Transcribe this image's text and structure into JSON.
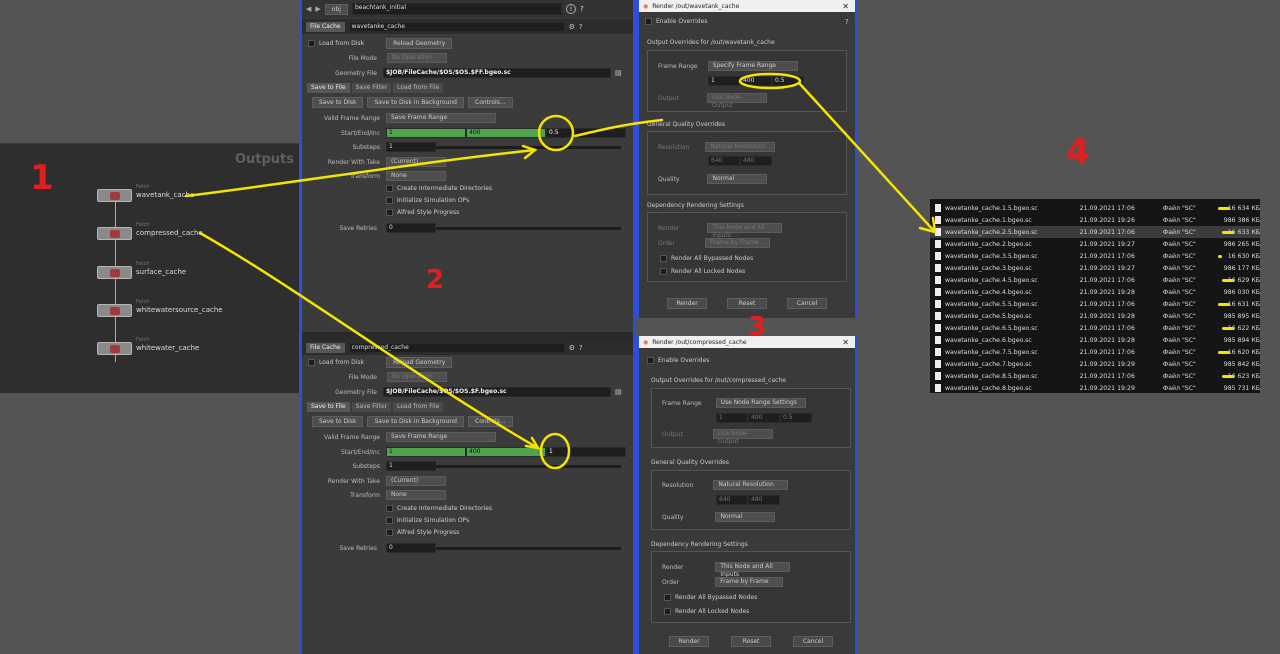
{
  "annotations": {
    "n1": "1",
    "n2": "2",
    "n3": "3",
    "n4": "4"
  },
  "outputs": {
    "title": "Outputs",
    "nodes": [
      {
        "type": "Fetch",
        "name": "wavetank_cache"
      },
      {
        "type": "Fetch",
        "name": "compressed_cache"
      },
      {
        "type": "Fetch",
        "name": "surface_cache"
      },
      {
        "type": "Fetch",
        "name": "whitewatersource_cache"
      },
      {
        "type": "Fetch",
        "name": "whitewater_cache"
      }
    ]
  },
  "path_bar": {
    "obj": "obj",
    "node": "beachtank_initial"
  },
  "fc1": {
    "node_type": "File Cache",
    "node_name": "wavetanke_cache",
    "load_from_disk": "Load from Disk",
    "reload": "Reload Geometry",
    "file_mode_label": "File Mode",
    "file_mode": "No Operation",
    "geo_label": "Geometry File",
    "geo_file": "$JOB/FileCache/$OS/$OS.$FF.bgeo.sc",
    "tabs": [
      "Save to File",
      "Save Filter",
      "Load from File"
    ],
    "save_btns": [
      "Save to Disk",
      "Save to Disk in Background",
      "Controls..."
    ],
    "valid_label": "Valid Frame Range",
    "valid": "Save Frame Range",
    "sei_label": "Start/End/Inc",
    "start": "1",
    "end": "400",
    "inc": "0.5",
    "substeps_label": "Substeps",
    "substeps": "1",
    "take_label": "Render With Take",
    "take": "(Current)",
    "transform_label": "Transform",
    "transform": "None",
    "chk": [
      "Create Intermediate Directories",
      "Initialize Simulation OPs",
      "Alfred Style Progress"
    ],
    "retries_label": "Save Retries",
    "retries": "0"
  },
  "fc2": {
    "node_type": "File Cache",
    "node_name": "compressed_cache",
    "load_from_disk": "Load from Disk",
    "reload": "Reload Geometry",
    "file_mode_label": "File Mode",
    "file_mode": "No Operation",
    "geo_label": "Geometry File",
    "geo_file": "$JOB/FileCache/$OS/$OS.$F.bgeo.sc",
    "tabs": [
      "Save to File",
      "Save Filter",
      "Load from File"
    ],
    "save_btns": [
      "Save to Disk",
      "Save to Disk in Background",
      "Controls..."
    ],
    "valid_label": "Valid Frame Range",
    "valid": "Save Frame Range",
    "sei_label": "Start/End/Inc",
    "start": "1",
    "end": "400",
    "inc": "1",
    "substeps_label": "Substeps",
    "substeps": "1",
    "take_label": "Render With Take",
    "take": "(Current)",
    "transform_label": "Transform",
    "transform": "None",
    "chk": [
      "Create Intermediate Directories",
      "Initialize Simulation OPs",
      "Alfred Style Progress"
    ],
    "retries_label": "Save Retries",
    "retries": "0"
  },
  "r1": {
    "title": "Render /out/wavetank_cache",
    "enable": "Enable Overrides",
    "out_group": "Output Overrides for /out/wavetank_cache",
    "fr_label": "Frame Range",
    "fr": "Specify Frame Range",
    "f1": "1",
    "f2": "400",
    "f3": "0.5",
    "out_label": "Output",
    "out": "Use Node Output",
    "q_group": "General Quality Overrides",
    "res_label": "Resolution",
    "res": "Natural Resolution",
    "w": "640",
    "h": "480",
    "qual_label": "Quality",
    "qual": "Normal",
    "dep_group": "Dependency Rendering Settings",
    "render_label": "Render",
    "render": "This Node and All Inputs",
    "order_label": "Order",
    "order": "Frame by Frame",
    "bypassed": "Render All Bypassed Nodes",
    "locked": "Render All Locked Nodes",
    "buttons": [
      "Render",
      "Reset",
      "Cancel"
    ]
  },
  "r2": {
    "title": "Render /out/compressed_cache",
    "enable": "Enable Overrides",
    "out_group": "Output Overrides for /out/compressed_cache",
    "fr_label": "Frame Range",
    "fr": "Use Node Range Settings",
    "f1": "1",
    "f2": "400",
    "f3": "0.5",
    "out_label": "Output",
    "out": "Use Node Output",
    "q_group": "General Quality Overrides",
    "res_label": "Resolution",
    "res": "Natural Resolution",
    "w": "640",
    "h": "480",
    "qual_label": "Quality",
    "qual": "Normal",
    "dep_group": "Dependency Rendering Settings",
    "render_label": "Render",
    "render": "This Node and All Inputs",
    "order_label": "Order",
    "order": "Frame by Frame",
    "bypassed": "Render All Bypassed Nodes",
    "locked": "Render All Locked Nodes",
    "buttons": [
      "Render",
      "Reset",
      "Cancel"
    ]
  },
  "files": [
    {
      "name": "wavetanke_cache.1.5.bgeo.sc",
      "date": "21.09.2021 17:06",
      "type": "Файл \"SC\"",
      "size": "16 634 КБ"
    },
    {
      "name": "wavetanke_cache.1.bgeo.sc",
      "date": "21.09.2021 19:26",
      "type": "Файл \"SC\"",
      "size": "986 386 КБ"
    },
    {
      "name": "wavetanke_cache.2.5.bgeo.sc",
      "date": "21.09.2021 17:06",
      "type": "Файл \"SC\"",
      "size": "16 633 КБ"
    },
    {
      "name": "wavetanke_cache.2.bgeo.sc",
      "date": "21.09.2021 19:27",
      "type": "Файл \"SC\"",
      "size": "986 265 КБ"
    },
    {
      "name": "wavetanke_cache.3.5.bgeo.sc",
      "date": "21.09.2021 17:06",
      "type": "Файл \"SC\"",
      "size": "16 630 КБ"
    },
    {
      "name": "wavetanke_cache.3.bgeo.sc",
      "date": "21.09.2021 19:27",
      "type": "Файл \"SC\"",
      "size": "986 177 КБ"
    },
    {
      "name": "wavetanke_cache.4.5.bgeo.sc",
      "date": "21.09.2021 17:06",
      "type": "Файл \"SC\"",
      "size": "16 629 КБ"
    },
    {
      "name": "wavetanke_cache.4.bgeo.sc",
      "date": "21.09.2021 19:28",
      "type": "Файл \"SC\"",
      "size": "986 030 КБ"
    },
    {
      "name": "wavetanke_cache.5.5.bgeo.sc",
      "date": "21.09.2021 17:06",
      "type": "Файл \"SC\"",
      "size": "16 631 КБ"
    },
    {
      "name": "wavetanke_cache.5.bgeo.sc",
      "date": "21.09.2021 19:28",
      "type": "Файл \"SC\"",
      "size": "985 895 КБ"
    },
    {
      "name": "wavetanke_cache.6.5.bgeo.sc",
      "date": "21.09.2021 17:06",
      "type": "Файл \"SC\"",
      "size": "16 622 КБ"
    },
    {
      "name": "wavetanke_cache.6.bgeo.sc",
      "date": "21.09.2021 19:28",
      "type": "Файл \"SC\"",
      "size": "985 894 КБ"
    },
    {
      "name": "wavetanke_cache.7.5.bgeo.sc",
      "date": "21.09.2021 17:06",
      "type": "Файл \"SC\"",
      "size": "16 620 КБ"
    },
    {
      "name": "wavetanke_cache.7.bgeo.sc",
      "date": "21.09.2021 19:29",
      "type": "Файл \"SC\"",
      "size": "985 842 КБ"
    },
    {
      "name": "wavetanke_cache.8.5.bgeo.sc",
      "date": "21.09.2021 17:06",
      "type": "Файл \"SC\"",
      "size": "16 623 КБ"
    },
    {
      "name": "wavetanke_cache.8.bgeo.sc",
      "date": "21.09.2021 19:29",
      "type": "Файл \"SC\"",
      "size": "985 731 КБ"
    }
  ],
  "colors": {
    "annotation_red": "#e02020",
    "highlight_yellow": "#f5e400",
    "accent_blue": "#2b4fd8"
  }
}
